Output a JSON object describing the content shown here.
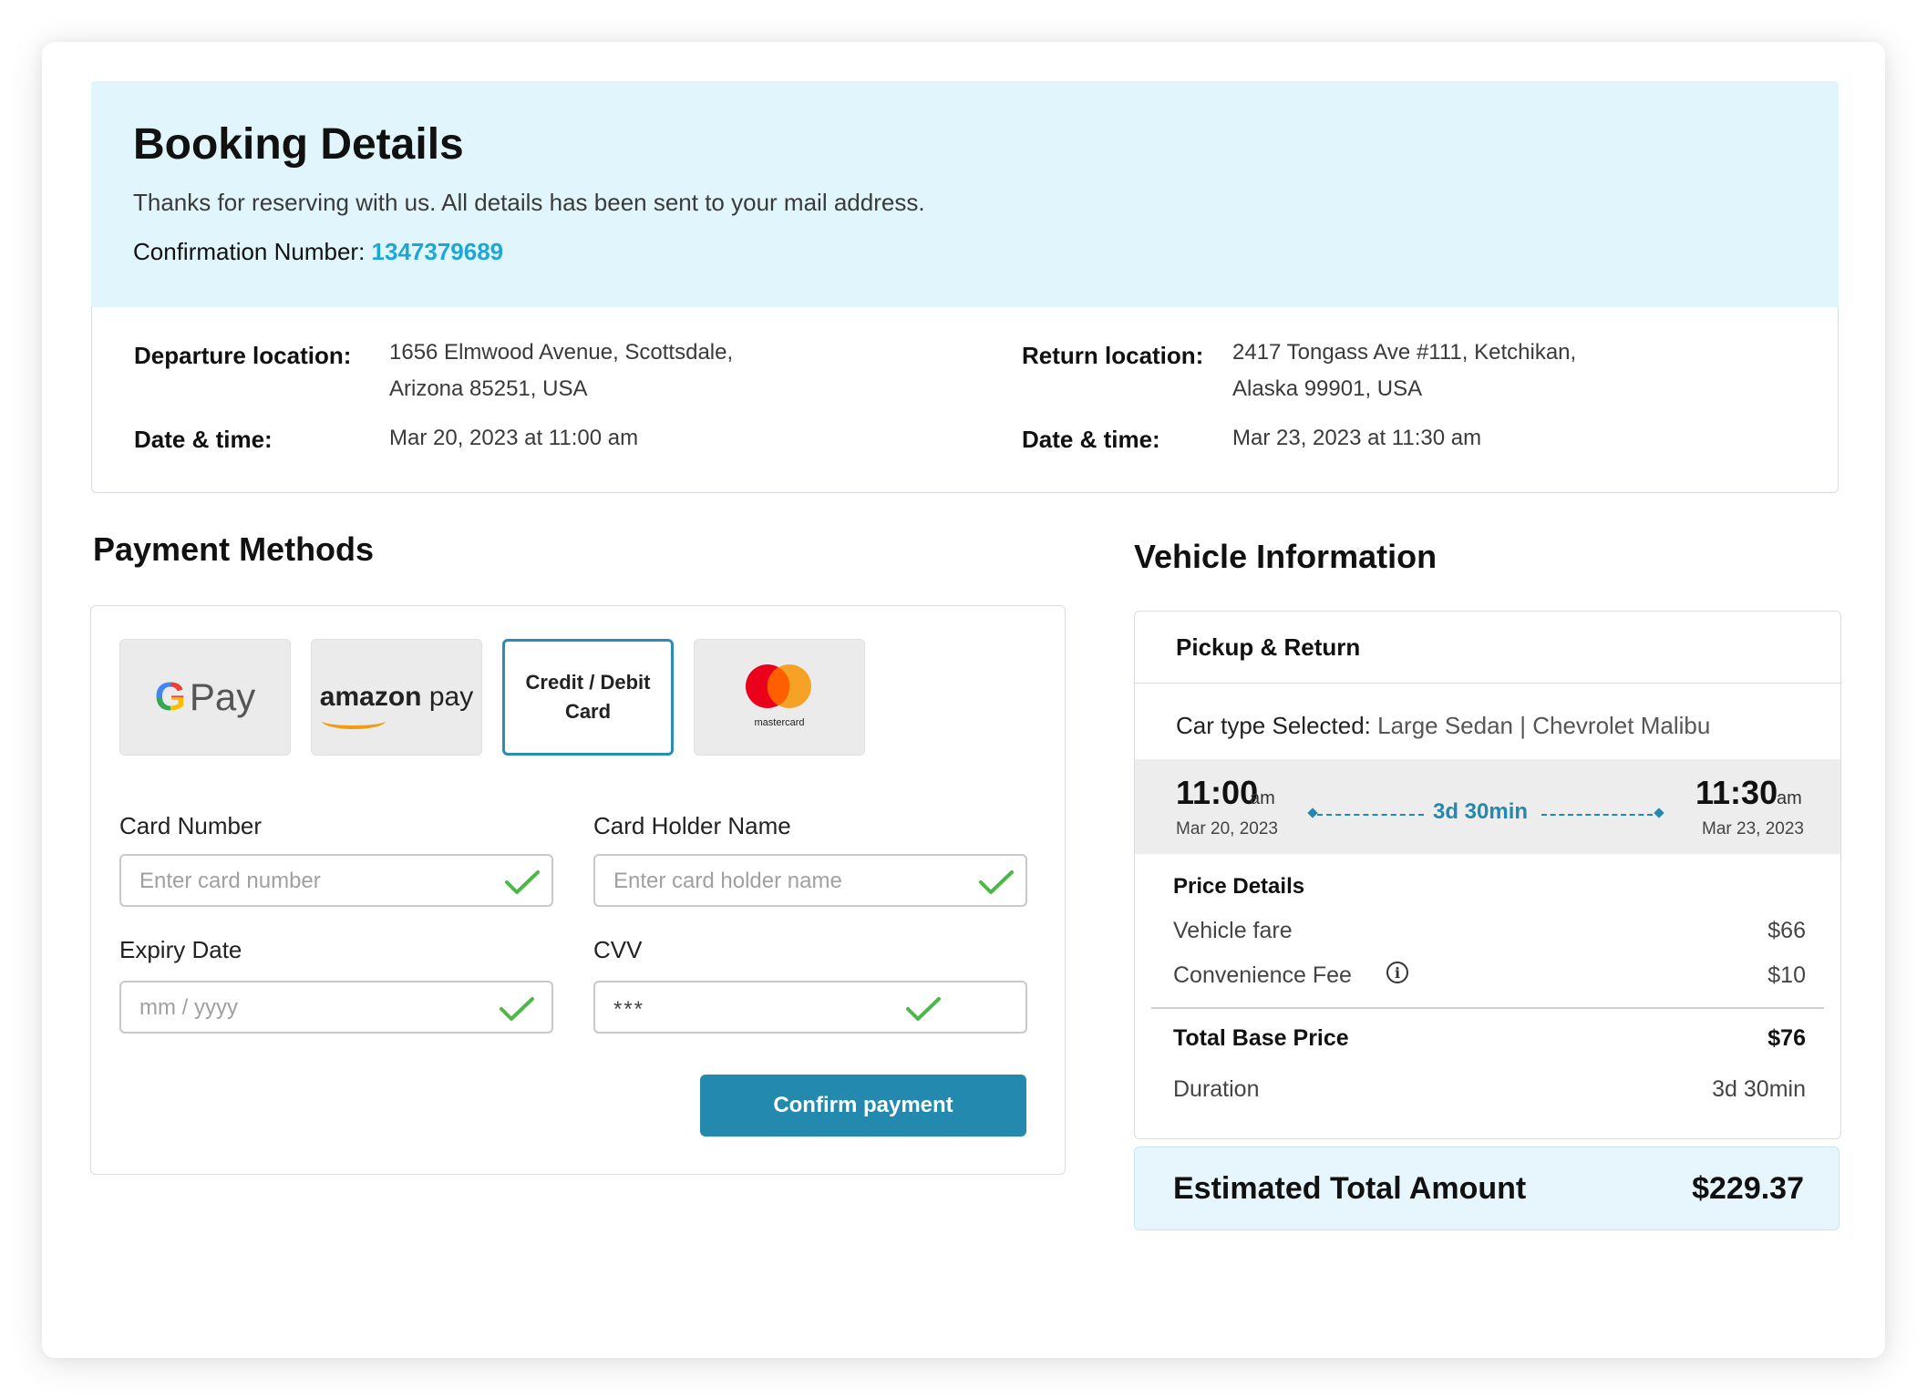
{
  "booking": {
    "title": "Booking Details",
    "subtitle": "Thanks for reserving with us. All details has been sent to your mail address.",
    "confirmation_label": "Confirmation Number:",
    "confirmation_number": "1347379689",
    "departure_label": "Departure  location:",
    "departure_line1": "1656 Elmwood Avenue, Scottsdale,",
    "departure_line2": "Arizona 85251, USA",
    "departure_dt_label": "Date & time:",
    "departure_dt": "Mar 20, 2023  at  11:00 am",
    "return_label": "Return location:",
    "return_line1": "2417 Tongass Ave #111, Ketchikan,",
    "return_line2": "Alaska 99901, USA",
    "return_dt_label": "Date & time:",
    "return_dt": "Mar 23, 2023  at  11:30 am"
  },
  "payment": {
    "title": "Payment Methods",
    "methods": {
      "gpay": "Pay",
      "amazon_bold": "amazon",
      "amazon_rest": " pay",
      "card_line1": "Credit / Debit",
      "card_line2": "Card",
      "mastercard": "mastercard"
    },
    "card_number_label": "Card Number",
    "card_number_placeholder": "Enter card number",
    "holder_label": "Card Holder Name",
    "holder_placeholder": "Enter card holder name",
    "expiry_label": "Expiry Date",
    "expiry_placeholder": "mm / yyyy",
    "cvv_label": "CVV",
    "cvv_value": "***",
    "confirm_label": "Confirm payment",
    "check_color": "#4cb847",
    "accent": "#2389ae"
  },
  "vehicle": {
    "title": "Vehicle Information",
    "tab_label": "Pickup & Return",
    "car_type_label": "Car type Selected:",
    "car_type_value": " Large Sedan  |  Chevrolet Malibu",
    "pickup_time": "11:00",
    "pickup_ampm": "am",
    "pickup_date": "Mar 20, 2023",
    "duration": "3d 30min",
    "return_time": "11:30",
    "return_ampm": "am",
    "return_date": "Mar 23, 2023",
    "price_title": "Price Details",
    "fare_label": "Vehicle fare",
    "fare_value": "$66",
    "fee_label": "Convenience Fee",
    "fee_value": "$10",
    "info_glyph": "i",
    "total_base_label": "Total Base Price",
    "total_base_value": "$76",
    "duration_label": "Duration",
    "duration_value": "3d 30min"
  },
  "estimate": {
    "label": "Estimated Total Amount",
    "value": "$229.37"
  }
}
